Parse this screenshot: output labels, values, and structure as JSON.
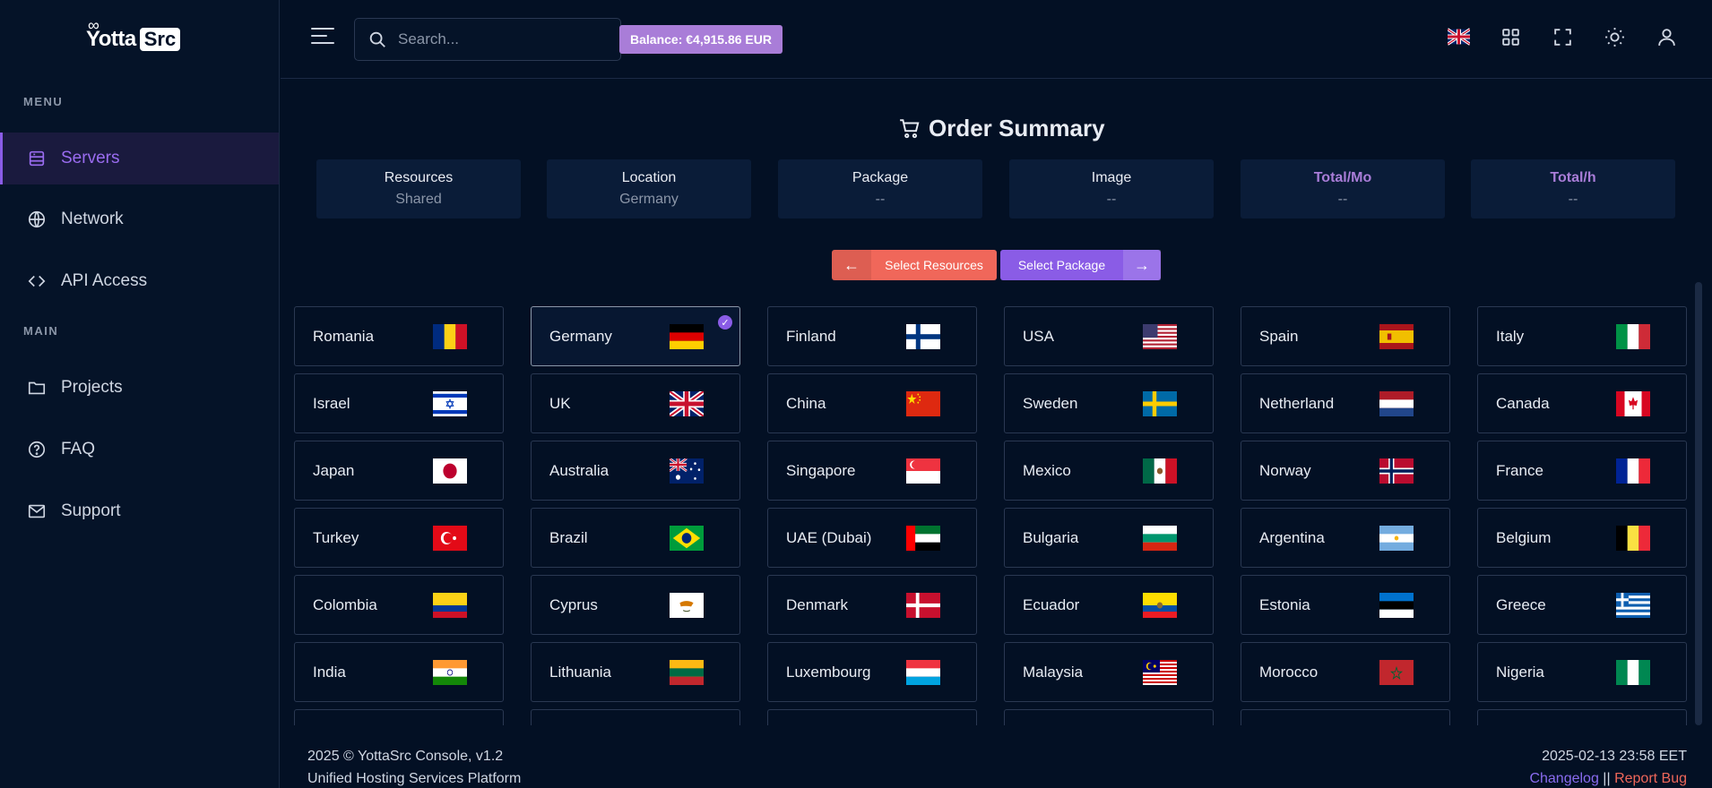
{
  "brand": {
    "name_part1": "Yotta",
    "name_part2": "Src"
  },
  "sidebar": {
    "menu_label": "MENU",
    "main_label": "MAIN",
    "items": [
      {
        "label": "Servers",
        "icon": "server-icon",
        "active": true
      },
      {
        "label": "Network",
        "icon": "globe-icon",
        "active": false
      },
      {
        "label": "API Access",
        "icon": "code-icon",
        "active": false
      },
      {
        "label": "Projects",
        "icon": "folder-icon",
        "active": false
      },
      {
        "label": "FAQ",
        "icon": "question-icon",
        "active": false
      },
      {
        "label": "Support",
        "icon": "mail-icon",
        "active": false
      }
    ]
  },
  "topbar": {
    "search_placeholder": "Search...",
    "balance": "Balance: €4,915.86 EUR",
    "icons": [
      "uk-flag-icon",
      "apps-grid-icon",
      "fullscreen-icon",
      "theme-sun-icon",
      "user-icon"
    ]
  },
  "summary": {
    "title": "Order Summary",
    "cards": [
      {
        "label": "Resources",
        "value": "Shared"
      },
      {
        "label": "Location",
        "value": "Germany"
      },
      {
        "label": "Package",
        "value": "--"
      },
      {
        "label": "Image",
        "value": "--"
      },
      {
        "label": "Total/Mo",
        "value": "--"
      },
      {
        "label": "Total/h",
        "value": "--"
      }
    ]
  },
  "actions": {
    "back_label": "Select Resources",
    "next_label": "Select Package"
  },
  "countries": [
    {
      "name": "Romania",
      "flag": "romania",
      "selected": false
    },
    {
      "name": "Germany",
      "flag": "germany",
      "selected": true
    },
    {
      "name": "Finland",
      "flag": "finland",
      "selected": false
    },
    {
      "name": "USA",
      "flag": "usa",
      "selected": false
    },
    {
      "name": "Spain",
      "flag": "spain",
      "selected": false
    },
    {
      "name": "Italy",
      "flag": "italy",
      "selected": false
    },
    {
      "name": "Israel",
      "flag": "israel",
      "selected": false
    },
    {
      "name": "UK",
      "flag": "uk",
      "selected": false
    },
    {
      "name": "China",
      "flag": "china",
      "selected": false
    },
    {
      "name": "Sweden",
      "flag": "sweden",
      "selected": false
    },
    {
      "name": "Netherland",
      "flag": "netherlands",
      "selected": false
    },
    {
      "name": "Canada",
      "flag": "canada",
      "selected": false
    },
    {
      "name": "Japan",
      "flag": "japan",
      "selected": false
    },
    {
      "name": "Australia",
      "flag": "australia",
      "selected": false
    },
    {
      "name": "Singapore",
      "flag": "singapore",
      "selected": false
    },
    {
      "name": "Mexico",
      "flag": "mexico",
      "selected": false
    },
    {
      "name": "Norway",
      "flag": "norway",
      "selected": false
    },
    {
      "name": "France",
      "flag": "france",
      "selected": false
    },
    {
      "name": "Turkey",
      "flag": "turkey",
      "selected": false
    },
    {
      "name": "Brazil",
      "flag": "brazil",
      "selected": false
    },
    {
      "name": "UAE (Dubai)",
      "flag": "uae",
      "selected": false
    },
    {
      "name": "Bulgaria",
      "flag": "bulgaria",
      "selected": false
    },
    {
      "name": "Argentina",
      "flag": "argentina",
      "selected": false
    },
    {
      "name": "Belgium",
      "flag": "belgium",
      "selected": false
    },
    {
      "name": "Colombia",
      "flag": "colombia",
      "selected": false
    },
    {
      "name": "Cyprus",
      "flag": "cyprus",
      "selected": false
    },
    {
      "name": "Denmark",
      "flag": "denmark",
      "selected": false
    },
    {
      "name": "Ecuador",
      "flag": "ecuador",
      "selected": false
    },
    {
      "name": "Estonia",
      "flag": "estonia",
      "selected": false
    },
    {
      "name": "Greece",
      "flag": "greece",
      "selected": false
    },
    {
      "name": "India",
      "flag": "india",
      "selected": false
    },
    {
      "name": "Lithuania",
      "flag": "lithuania",
      "selected": false
    },
    {
      "name": "Luxembourg",
      "flag": "luxembourg",
      "selected": false
    },
    {
      "name": "Malaysia",
      "flag": "malaysia",
      "selected": false
    },
    {
      "name": "Morocco",
      "flag": "morocco",
      "selected": false
    },
    {
      "name": "Nigeria",
      "flag": "nigeria",
      "selected": false
    }
  ],
  "footer": {
    "copyright": "2025 © YottaSrc Console, v1.2",
    "tagline": "Unified Hosting Services Platform",
    "datetime": "2025-02-13 23:58 EET",
    "changelog": "Changelog",
    "separator": "||",
    "report_bug": "Report Bug"
  },
  "colors": {
    "accent": "#8a5ce6",
    "balance_bg": "#a97dd8",
    "back_button": "#f0675a",
    "background": "#031024"
  }
}
